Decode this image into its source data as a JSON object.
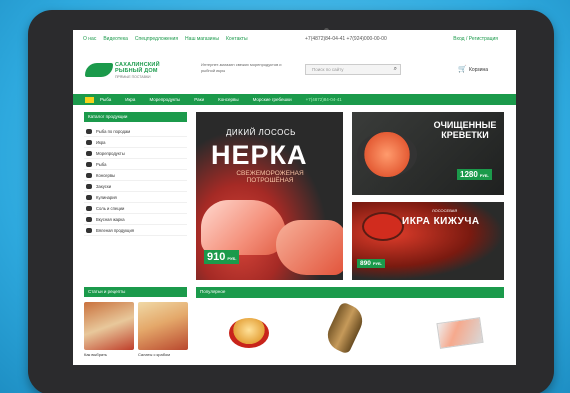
{
  "topbar": {
    "nav": [
      "О нас",
      "Видеотека",
      "Спецпредложения",
      "Наш магазины",
      "Контакты"
    ],
    "phones": "+7(4872)84-04-41  +7(924)000-00-00",
    "cabinet": "Вход / Регистрация"
  },
  "logo": {
    "line1": "САХАЛИНСКИЙ",
    "line2": "РЫБНЫЙ ДОМ",
    "line3": "ПРЯМЫЕ ПОСТАВКИ"
  },
  "header": {
    "tagline": "Интернет-магазин свежих морепродуктов и рыбной икры",
    "search_placeholder": "Поиск по сайту",
    "cart_label": "Корзина"
  },
  "nav": {
    "items": [
      "Рыба",
      "Икра",
      "Морепродукты",
      "Раки",
      "Консервы",
      "Морские гребешки"
    ],
    "promo": "+7(4872)84-04-41"
  },
  "sidebar": {
    "catalog_title": "Каталог продукции",
    "categories": [
      "Рыба по породам",
      "Икра",
      "Морепродукты",
      "Рыба",
      "Консервы",
      "Закуски",
      "Кулинария",
      "Соль и специи",
      "Вкусная жарка",
      "Вяленая продукция"
    ],
    "recipes_title": "Статьи и рецепты",
    "recipe_captions": [
      "Как выбрать",
      "Салаты с крабом"
    ]
  },
  "banners": {
    "b1_line1": "ДИКИЙ ЛОСОСЬ",
    "b1_title": "НЕРКА",
    "b1_line3": "СВЕЖЕМОРОЖЕНАЯ ПОТРОШЁНАЯ",
    "b1_price": "910",
    "b2_title": "ОЧИЩЕННЫЕ КРЕВЕТКИ",
    "b2_price": "1280",
    "b3_pre": "ЛОСОСЕВАЯ",
    "b3_title": "ИКРА КИЖУЧА",
    "b3_price": "890",
    "currency": "РУБ."
  },
  "popular": {
    "title": "Популярное"
  },
  "colors": {
    "brand_green": "#1b9a4b"
  }
}
